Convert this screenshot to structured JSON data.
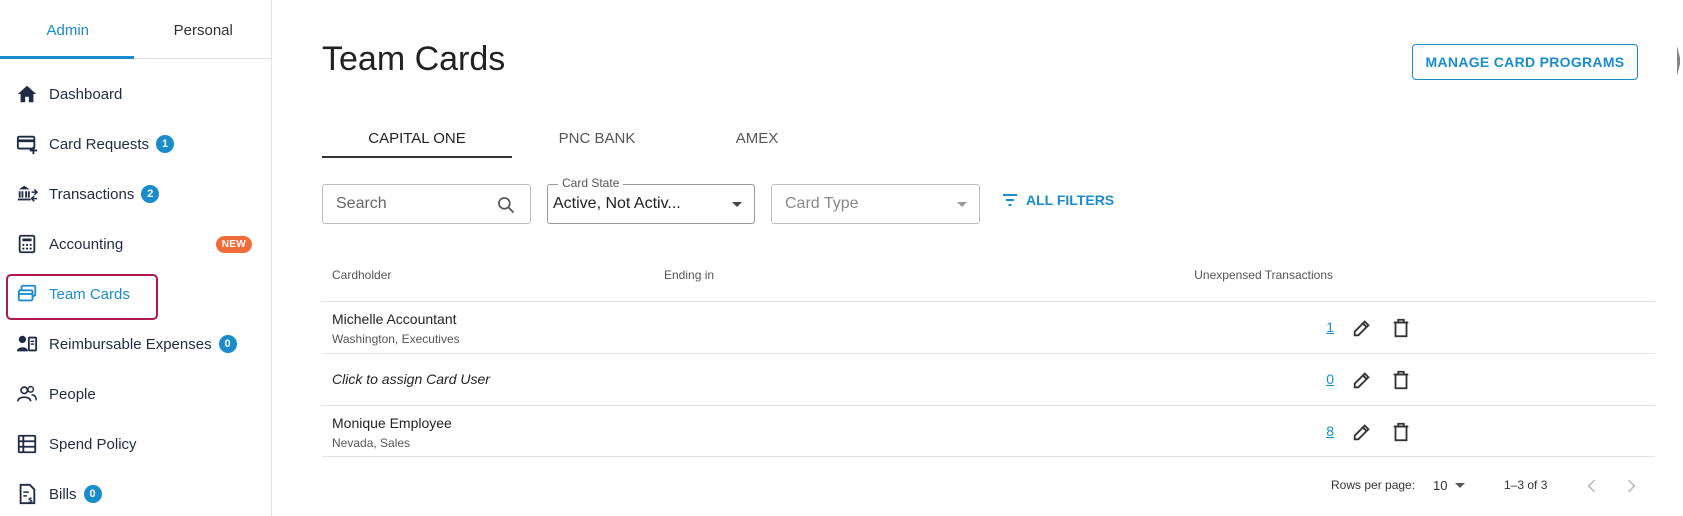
{
  "sidebar": {
    "tabs": [
      {
        "label": "Admin",
        "active": true
      },
      {
        "label": "Personal",
        "active": false
      }
    ],
    "items": [
      {
        "label": "Dashboard",
        "icon": "home-icon"
      },
      {
        "label": "Card Requests",
        "icon": "card-add-icon",
        "badge": "1"
      },
      {
        "label": "Transactions",
        "icon": "bank-transfer-icon",
        "badge": "2"
      },
      {
        "label": "Accounting",
        "icon": "calculator-icon",
        "tag": "NEW"
      },
      {
        "label": "Team Cards",
        "icon": "cards-icon",
        "active": true
      },
      {
        "label": "Reimbursable Expenses",
        "icon": "person-receipt-icon",
        "badge": "0"
      },
      {
        "label": "People",
        "icon": "people-icon"
      },
      {
        "label": "Spend Policy",
        "icon": "policy-icon"
      },
      {
        "label": "Bills",
        "icon": "bill-icon",
        "badge": "0"
      }
    ]
  },
  "header": {
    "title": "Team Cards",
    "manage_button": "MANAGE CARD PROGRAMS"
  },
  "tabs": [
    {
      "label": "CAPITAL ONE",
      "active": true
    },
    {
      "label": "PNC BANK",
      "active": false
    },
    {
      "label": "AMEX",
      "active": false
    }
  ],
  "filters": {
    "search_placeholder": "Search",
    "card_state_label": "Card State",
    "card_state_value": "Active, Not Activ...",
    "card_type_placeholder": "Card Type",
    "all_filters": "ALL FILTERS"
  },
  "table": {
    "columns": [
      "Cardholder",
      "Ending in",
      "Unexpensed Transactions"
    ],
    "rows": [
      {
        "name": "Michelle Accountant",
        "sub": "Washington, Executives",
        "ending": "",
        "unexpensed": "1"
      },
      {
        "name": "Click to assign Card User",
        "sub": "",
        "ending": "",
        "unexpensed": "0"
      },
      {
        "name": "Monique Employee",
        "sub": "Nevada, Sales",
        "ending": "",
        "unexpensed": "8"
      }
    ]
  },
  "pagination": {
    "rows_per_page_label": "Rows per page:",
    "rows_per_page": "10",
    "range": "1–3 of 3"
  },
  "colors": {
    "accent": "#1a8ccc",
    "highlight": "#b0184f",
    "new_tag": "#f26b3a"
  }
}
